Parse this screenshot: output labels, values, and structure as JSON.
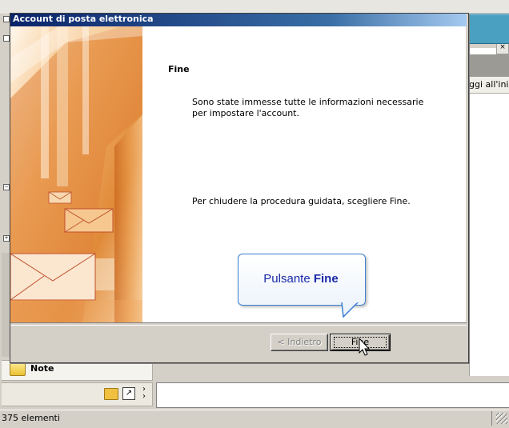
{
  "colors": {
    "title_bar": "#0a246a",
    "callout_border": "#3a7fd0",
    "callout_text": "#1a2aa8",
    "accent_teal": "#4aa0c0"
  },
  "background": {
    "right_toolbar_text": "ggi all'inizio",
    "notes_label": "Note",
    "status_text": "375 elementi",
    "icons": [
      "folder-icon",
      "shortcut-icon",
      "more-chevron-icon",
      "notes-icon"
    ]
  },
  "dialog": {
    "title": "Account di posta elettronica",
    "heading": "Fine",
    "para1": "Sono state immesse tutte le informazioni necessarie per impostare l'account.",
    "para2": "Per chiudere la procedura guidata, scegliere Fine.",
    "back_label": "< Indietro",
    "finish_label": "Fine"
  },
  "callout": {
    "prefix": "Pulsante ",
    "bold": "Fine"
  }
}
